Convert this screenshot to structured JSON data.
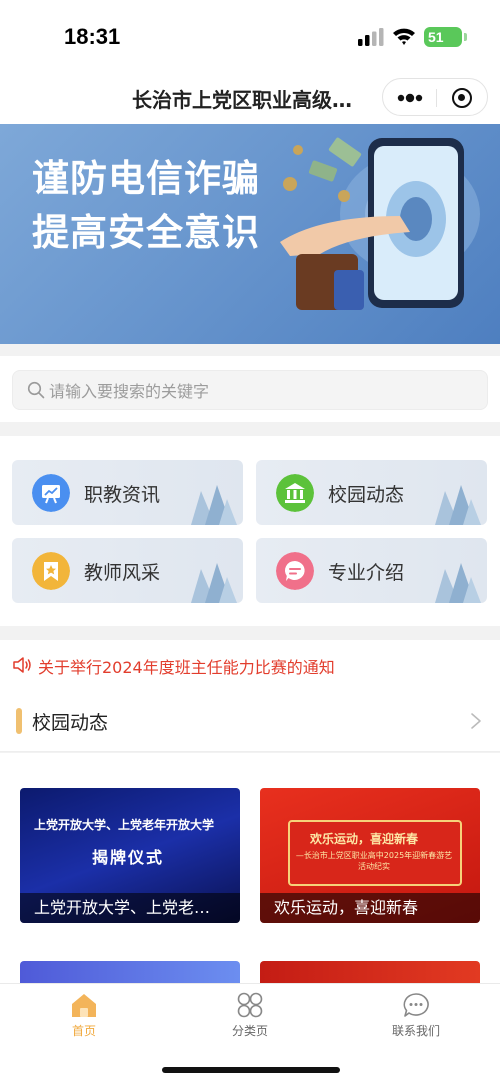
{
  "status_bar": {
    "time": "18:31",
    "battery": "51"
  },
  "navbar": {
    "title": "长治市上党区职业高级…"
  },
  "banner": {
    "line1": "谨防电信诈骗",
    "line2": "提高安全意识",
    "slide_count": 7,
    "active_slide": 3
  },
  "search": {
    "placeholder": "请输入要搜索的关键字"
  },
  "categories": [
    {
      "label": "职教资讯",
      "icon": "presentation-icon",
      "color": "#4a8ff0"
    },
    {
      "label": "校园动态",
      "icon": "campus-building-icon",
      "color": "#5cc23a"
    },
    {
      "label": "教师风采",
      "icon": "teacher-badge-icon",
      "color": "#f2b53a"
    },
    {
      "label": "专业介绍",
      "icon": "chat-bubble-icon",
      "color": "#f0708a"
    }
  ],
  "notice": {
    "text": "关于举行2024年度班主任能力比赛的通知"
  },
  "section": {
    "title": "校园动态"
  },
  "news": [
    {
      "caption": "上党开放大学、上党老…",
      "image_title": "上党开放大学、上党老年开放大学",
      "image_subtitle": "揭牌仪式"
    },
    {
      "caption": "欢乐运动，喜迎新春",
      "image_title": "欢乐运动，喜迎新春",
      "image_subtitle": "—长治市上党区职业高中2025年迎新春游艺活动纪实"
    }
  ],
  "tabbar": {
    "items": [
      {
        "label": "首页",
        "active": true
      },
      {
        "label": "分类页",
        "active": false
      },
      {
        "label": "联系我们",
        "active": false
      }
    ]
  },
  "colors": {
    "accent": "#f0a83c",
    "notice": "#e23d2d",
    "section_bar": "#f0c070"
  }
}
